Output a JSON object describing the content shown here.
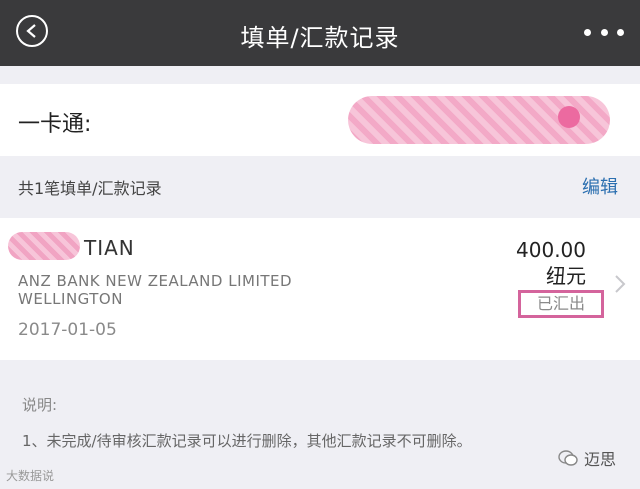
{
  "header": {
    "title": "填单/汇款记录",
    "back_icon": "back-chevron-icon",
    "more_icon": "more-dots-icon"
  },
  "card": {
    "label": "一卡通:"
  },
  "section": {
    "count_text": "共1笔填单/汇款记录",
    "edit_label": "编辑"
  },
  "record": {
    "payee_name": "TIAN",
    "bank_name_line1": "ANZ BANK NEW ZEALAND LIMITED",
    "bank_name_line2": "WELLINGTON",
    "date": "2017-01-05",
    "amount": "400.00",
    "currency": "纽元",
    "status": "已汇出"
  },
  "notes": {
    "title": "说明:",
    "items": [
      "1、未完成/待审核汇款记录可以进行删除，其他汇款记录不可删除。"
    ]
  },
  "watermarks": {
    "left": "大数据说",
    "right": "迈思"
  },
  "colors": {
    "header_bg": "#3a3a3c",
    "link": "#2b6fb0",
    "status_border": "#d4649c"
  }
}
